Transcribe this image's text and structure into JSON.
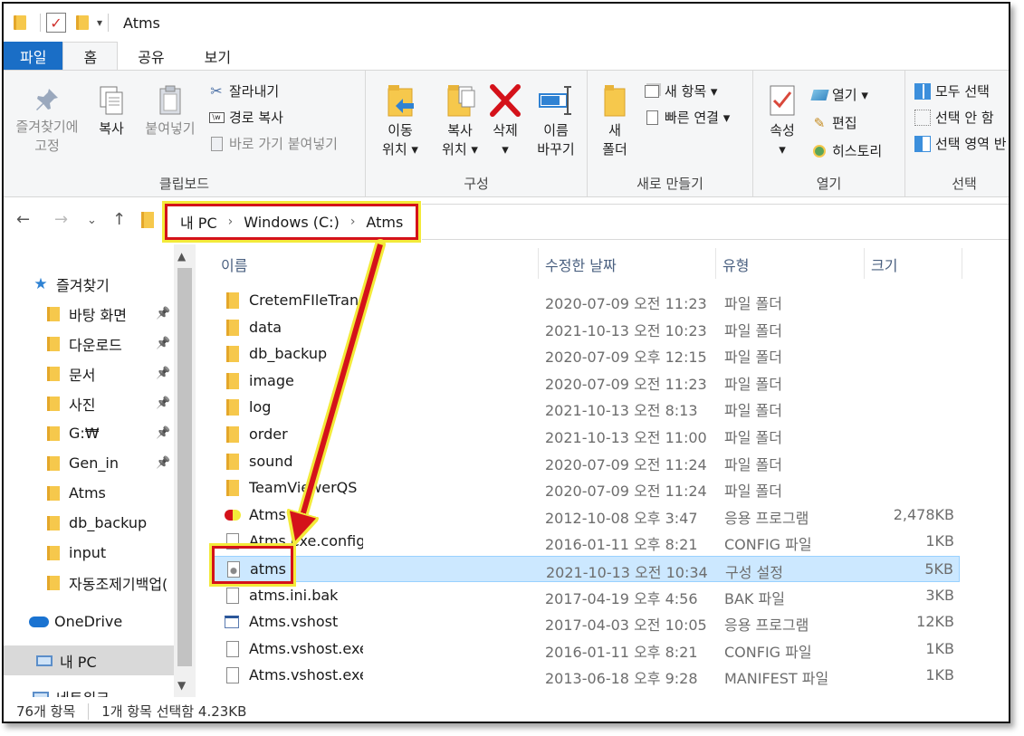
{
  "window": {
    "title": "Atms"
  },
  "tabs": [
    {
      "label": "파일"
    },
    {
      "label": "홈"
    },
    {
      "label": "공유"
    },
    {
      "label": "보기"
    }
  ],
  "ribbon": {
    "clipboard": {
      "title": "클립보드",
      "pin_line1": "즐겨찾기에",
      "pin_line2": "고정",
      "copy": "복사",
      "paste": "붙여넣기",
      "cut": "잘라내기",
      "copy_path": "경로 복사",
      "paste_shortcut": "바로 가기 붙여넣기"
    },
    "organize": {
      "title": "구성",
      "move_line1": "이동",
      "move_line2": "위치 ▾",
      "copy_line1": "복사",
      "copy_line2": "위치 ▾",
      "delete_line1": "삭제",
      "delete_line2": "▾",
      "rename_line1": "이름",
      "rename_line2": "바꾸기"
    },
    "new": {
      "title": "새로 만들기",
      "folder_line1": "새",
      "folder_line2": "폴더",
      "new_item": "새 항목 ▾",
      "easy_access": "빠른 연결 ▾"
    },
    "open": {
      "title": "열기",
      "props_line1": "속성",
      "props_line2": "▾",
      "open": "열기 ▾",
      "edit": "편집",
      "history": "히스토리"
    },
    "select": {
      "title": "선택",
      "select_all": "모두 선택",
      "select_none": "선택 안 함",
      "invert": "선택 영역 반"
    }
  },
  "address": {
    "crumbs": [
      "내 PC",
      "Windows (C:)",
      "Atms"
    ]
  },
  "nav": {
    "quick_access": "즐겨찾기",
    "items": [
      {
        "label": "바탕 화면",
        "pinned": true
      },
      {
        "label": "다운로드",
        "pinned": true
      },
      {
        "label": "문서",
        "pinned": true
      },
      {
        "label": "사진",
        "pinned": true
      },
      {
        "label": "G:₩",
        "pinned": true
      },
      {
        "label": "Gen_in",
        "pinned": true
      },
      {
        "label": "Atms",
        "pinned": false
      },
      {
        "label": "db_backup",
        "pinned": false
      },
      {
        "label": "input",
        "pinned": false
      },
      {
        "label": "자동조제기백업(",
        "pinned": false
      }
    ],
    "onedrive": "OneDrive",
    "this_pc": "내 PC",
    "network": "네트워크"
  },
  "columns": {
    "name": "이름",
    "date": "수정한 날짜",
    "type": "유형",
    "size": "크기"
  },
  "files": [
    {
      "name": "CretemFIleTransf",
      "date": "2020-07-09 오전 11:23",
      "type": "파일 폴더",
      "size": "",
      "kind": "folder"
    },
    {
      "name": "data",
      "date": "2021-10-13 오전 10:23",
      "type": "파일 폴더",
      "size": "",
      "kind": "folder"
    },
    {
      "name": "db_backup",
      "date": "2020-07-09 오후 12:15",
      "type": "파일 폴더",
      "size": "",
      "kind": "folder"
    },
    {
      "name": "image",
      "date": "2020-07-09 오전 11:23",
      "type": "파일 폴더",
      "size": "",
      "kind": "folder"
    },
    {
      "name": "log",
      "date": "2021-10-13 오전 8:13",
      "type": "파일 폴더",
      "size": "",
      "kind": "folder"
    },
    {
      "name": "order",
      "date": "2021-10-13 오전 11:00",
      "type": "파일 폴더",
      "size": "",
      "kind": "folder"
    },
    {
      "name": "sound",
      "date": "2020-07-09 오전 11:24",
      "type": "파일 폴더",
      "size": "",
      "kind": "folder"
    },
    {
      "name": "TeamViewerQS",
      "date": "2020-07-09 오전 11:24",
      "type": "파일 폴더",
      "size": "",
      "kind": "folder"
    },
    {
      "name": "Atms",
      "date": "2012-10-08 오후 3:47",
      "type": "응용 프로그램",
      "size": "2,478KB",
      "kind": "exe"
    },
    {
      "name": "Atms.exe.config",
      "date": "2016-01-11 오후 8:21",
      "type": "CONFIG 파일",
      "size": "1KB",
      "kind": "doc"
    },
    {
      "name": "atms",
      "date": "2021-10-13 오전 10:34",
      "type": "구성 설정",
      "size": "5KB",
      "kind": "ini",
      "selected": true
    },
    {
      "name": "atms.ini.bak",
      "date": "2017-04-19 오후 4:56",
      "type": "BAK 파일",
      "size": "3KB",
      "kind": "doc"
    },
    {
      "name": "Atms.vshost",
      "date": "2017-04-03 오전 10:05",
      "type": "응용 프로그램",
      "size": "12KB",
      "kind": "app"
    },
    {
      "name": "Atms.vshost.exe.config",
      "date": "2016-01-11 오후 8:21",
      "type": "CONFIG 파일",
      "size": "1KB",
      "kind": "doc"
    },
    {
      "name": "Atms.vshost.exe.manifest",
      "date": "2013-06-18 오후 9:28",
      "type": "MANIFEST 파일",
      "size": "1KB",
      "kind": "doc"
    }
  ],
  "status": {
    "count": "76개 항목",
    "selection": "1개 항목 선택함 4.23KB"
  }
}
